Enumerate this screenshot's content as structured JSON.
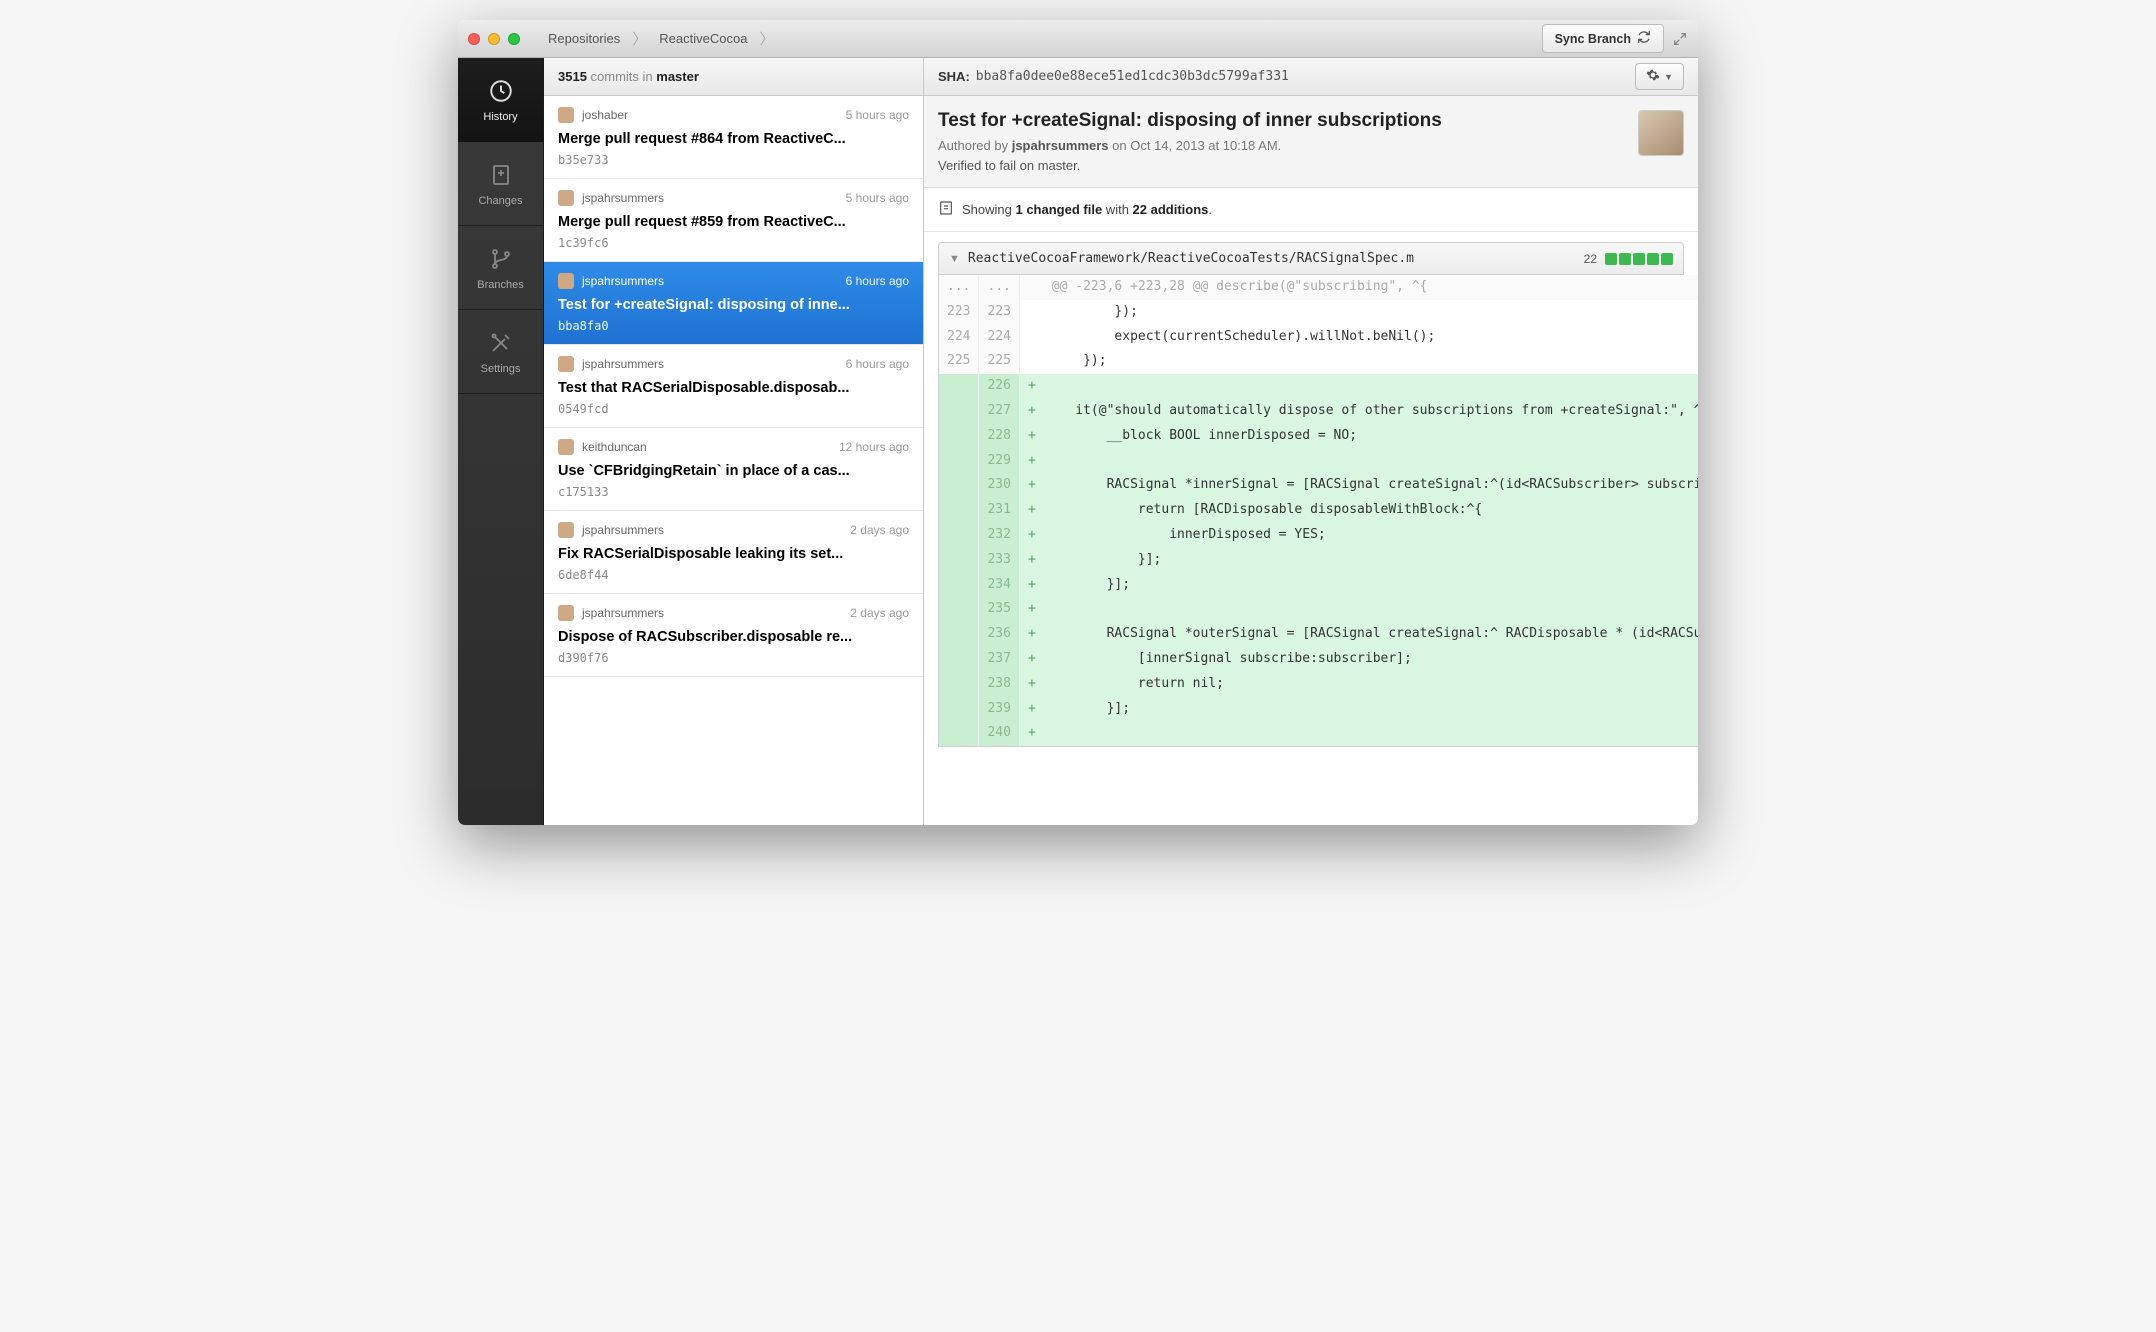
{
  "breadcrumbs": {
    "root": "Repositories",
    "repo": "ReactiveCocoa"
  },
  "sync_label": "Sync Branch",
  "sidebar": {
    "items": [
      {
        "label": "History"
      },
      {
        "label": "Changes"
      },
      {
        "label": "Branches"
      },
      {
        "label": "Settings"
      }
    ]
  },
  "list_header": {
    "count": "3515",
    "mid": " commits in ",
    "branch": "master"
  },
  "commits": [
    {
      "author": "joshaber",
      "time": "5 hours ago",
      "title": "Merge pull request #864 from ReactiveC...",
      "sha": "b35e733",
      "selected": false
    },
    {
      "author": "jspahrsummers",
      "time": "5 hours ago",
      "title": "Merge pull request #859 from ReactiveC...",
      "sha": "1c39fc6",
      "selected": false
    },
    {
      "author": "jspahrsummers",
      "time": "6 hours ago",
      "title": "Test for +createSignal: disposing of inne...",
      "sha": "bba8fa0",
      "selected": true
    },
    {
      "author": "jspahrsummers",
      "time": "6 hours ago",
      "title": "Test that RACSerialDisposable.disposab...",
      "sha": "0549fcd",
      "selected": false
    },
    {
      "author": "keithduncan",
      "time": "12 hours ago",
      "title": "Use `CFBridgingRetain` in place of a cas...",
      "sha": "c175133",
      "selected": false
    },
    {
      "author": "jspahrsummers",
      "time": "2 days ago",
      "title": "Fix RACSerialDisposable leaking its set...",
      "sha": "6de8f44",
      "selected": false
    },
    {
      "author": "jspahrsummers",
      "time": "2 days ago",
      "title": "Dispose of RACSubscriber.disposable re...",
      "sha": "d390f76",
      "selected": false
    }
  ],
  "detail": {
    "sha_label": "SHA:",
    "sha": "bba8fa0dee0e88ece51ed1cdc30b3dc5799af331",
    "title": "Test for +createSignal: disposing of inner subscriptions",
    "authored_prefix": "Authored by ",
    "authored_user": "jspahrsummers",
    "authored_suffix": " on Oct 14, 2013 at 10:18 AM.",
    "body": "Verified to fail on master.",
    "summary_prefix": "Showing ",
    "summary_files": "1 changed file",
    "summary_mid": " with ",
    "summary_adds": "22 additions",
    "summary_suffix": "."
  },
  "file": {
    "path": "ReactiveCocoaFramework/ReactiveCocoaTests/RACSignalSpec.m",
    "stat": "22"
  },
  "diff": [
    {
      "type": "hunk",
      "l": "...",
      "r": "...",
      "m": "",
      "c": "@@ -223,6 +223,28 @@ describe(@\"subscribing\", ^{"
    },
    {
      "type": "ctx",
      "l": "223",
      "r": "223",
      "m": "",
      "c": "        });"
    },
    {
      "type": "ctx",
      "l": "224",
      "r": "224",
      "m": "",
      "c": "        expect(currentScheduler).willNot.beNil();"
    },
    {
      "type": "ctx",
      "l": "225",
      "r": "225",
      "m": "",
      "c": "    });"
    },
    {
      "type": "add",
      "l": "",
      "r": "226",
      "m": "+",
      "c": ""
    },
    {
      "type": "add",
      "l": "",
      "r": "227",
      "m": "+",
      "c": "   it(@\"should automatically dispose of other subscriptions from +createSignal:\", ^{"
    },
    {
      "type": "add",
      "l": "",
      "r": "228",
      "m": "+",
      "c": "       __block BOOL innerDisposed = NO;"
    },
    {
      "type": "add",
      "l": "",
      "r": "229",
      "m": "+",
      "c": ""
    },
    {
      "type": "add",
      "l": "",
      "r": "230",
      "m": "+",
      "c": "       RACSignal *innerSignal = [RACSignal createSignal:^(id<RACSubscriber> subscriber) {"
    },
    {
      "type": "add",
      "l": "",
      "r": "231",
      "m": "+",
      "c": "           return [RACDisposable disposableWithBlock:^{"
    },
    {
      "type": "add",
      "l": "",
      "r": "232",
      "m": "+",
      "c": "               innerDisposed = YES;"
    },
    {
      "type": "add",
      "l": "",
      "r": "233",
      "m": "+",
      "c": "           }];"
    },
    {
      "type": "add",
      "l": "",
      "r": "234",
      "m": "+",
      "c": "       }];"
    },
    {
      "type": "add",
      "l": "",
      "r": "235",
      "m": "+",
      "c": ""
    },
    {
      "type": "add",
      "l": "",
      "r": "236",
      "m": "+",
      "c": "       RACSignal *outerSignal = [RACSignal createSignal:^ RACDisposable * (id<RACSubscriber> subscriber) {"
    },
    {
      "type": "add",
      "l": "",
      "r": "237",
      "m": "+",
      "c": "           [innerSignal subscribe:subscriber];"
    },
    {
      "type": "add",
      "l": "",
      "r": "238",
      "m": "+",
      "c": "           return nil;"
    },
    {
      "type": "add",
      "l": "",
      "r": "239",
      "m": "+",
      "c": "       }];"
    },
    {
      "type": "add",
      "l": "",
      "r": "240",
      "m": "+",
      "c": ""
    }
  ]
}
